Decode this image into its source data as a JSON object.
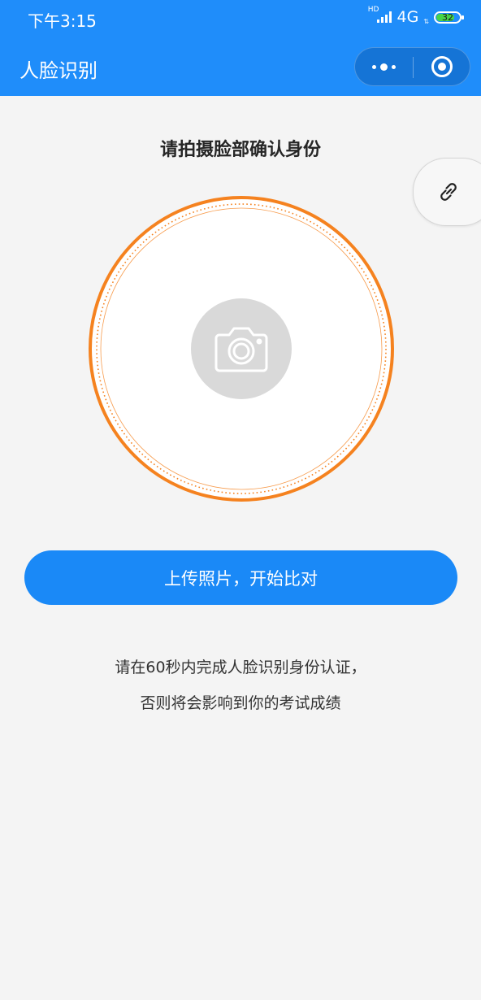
{
  "status_bar": {
    "time": "下午3:15",
    "hd": "HD",
    "network": "4G",
    "battery": "32"
  },
  "nav": {
    "title": "人脸识别"
  },
  "page": {
    "heading": "请拍摄脸部确认身份",
    "upload_button": "上传照片，开始比对",
    "notice_line1": "请在60秒内完成人脸识别身份认证，",
    "notice_line2": "否则将会影响到你的考试成绩"
  },
  "colors": {
    "brand": "#1f8dfa",
    "ring": "#f5821f",
    "background": "#f4f4f4"
  },
  "icons": {
    "camera": "camera-icon",
    "link": "link-icon",
    "more": "more-dots-icon",
    "close": "target-close-icon"
  }
}
